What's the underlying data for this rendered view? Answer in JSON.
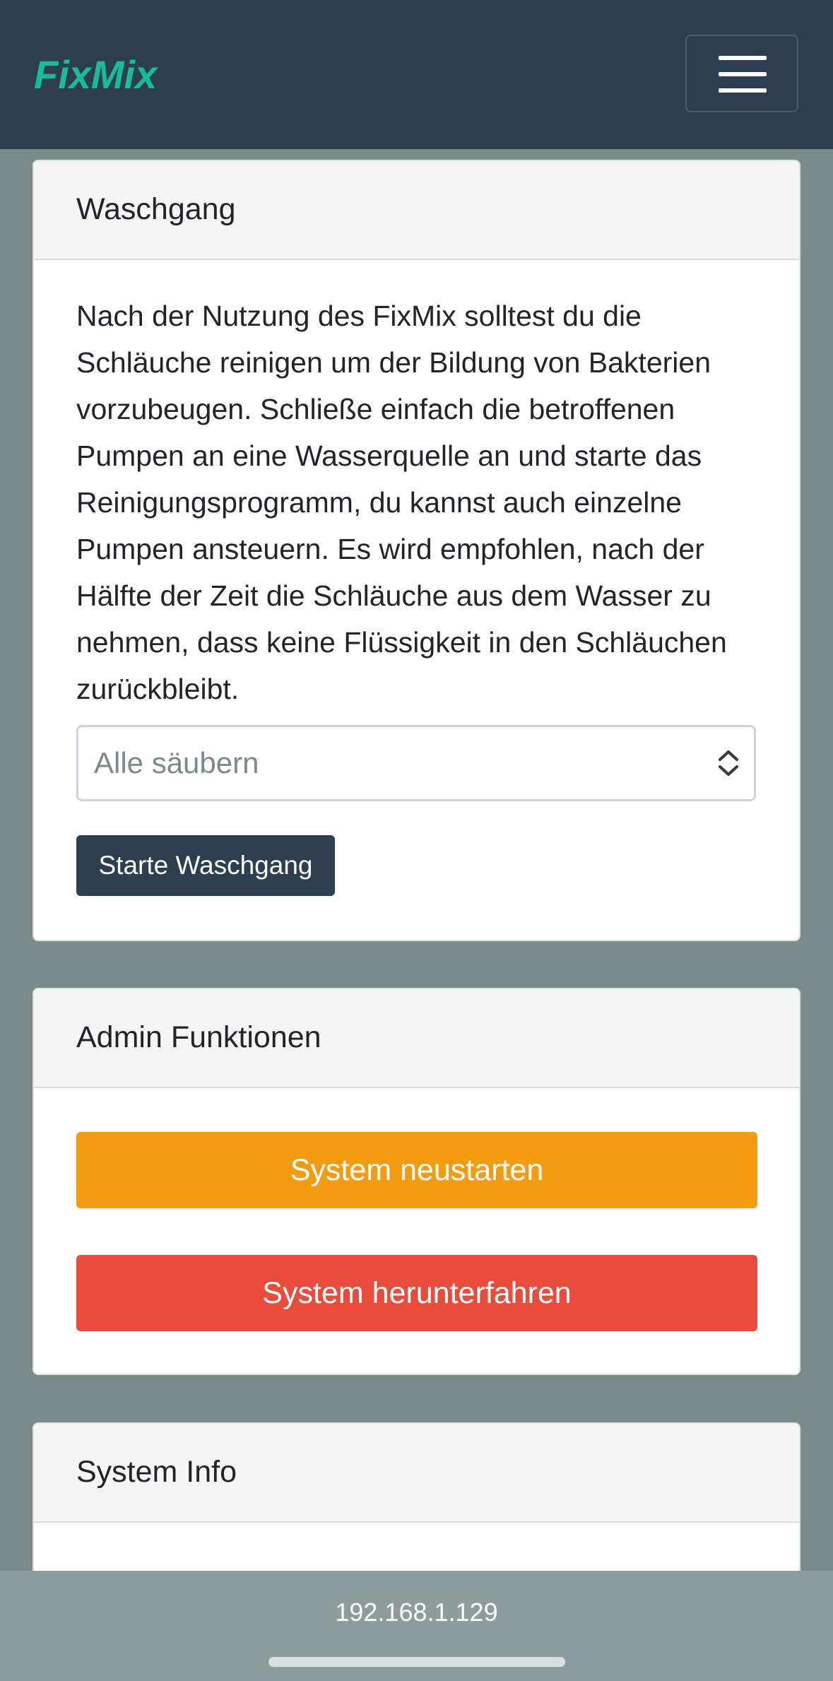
{
  "app": {
    "brand": "FixMix",
    "menu_icon": "hamburger-icon"
  },
  "wash_card": {
    "title": "Waschgang",
    "description": "Nach der Nutzung des FixMix solltest du die Schläuche reinigen um der Bildung von Bakterien vorzubeugen. Schließe einfach die betroffenen Pumpen an eine Wasserquelle an und starte das Reinigungsprogramm, du kannst auch einzelne Pumpen ansteuern. Es wird empfohlen, nach der Hälfte der Zeit die Schläuche aus dem Wasser zu nehmen, dass keine Flüssigkeit in den Schläuchen zurückbleibt.",
    "select_value": "Alle säubern",
    "select_icon": "chevron-up-down-icon",
    "start_button": "Starte Waschgang"
  },
  "admin_card": {
    "title": "Admin Funktionen",
    "restart_button": "System neustarten",
    "shutdown_button": "System herunterfahren"
  },
  "info_card": {
    "title": "System Info"
  },
  "browser": {
    "url": "192.168.1.129"
  },
  "colors": {
    "navbar": "#2c3e50",
    "brand": "#18bc9c",
    "page_background": "#7b8a8b",
    "warning": "#f39c12",
    "danger": "#e74c3c"
  }
}
